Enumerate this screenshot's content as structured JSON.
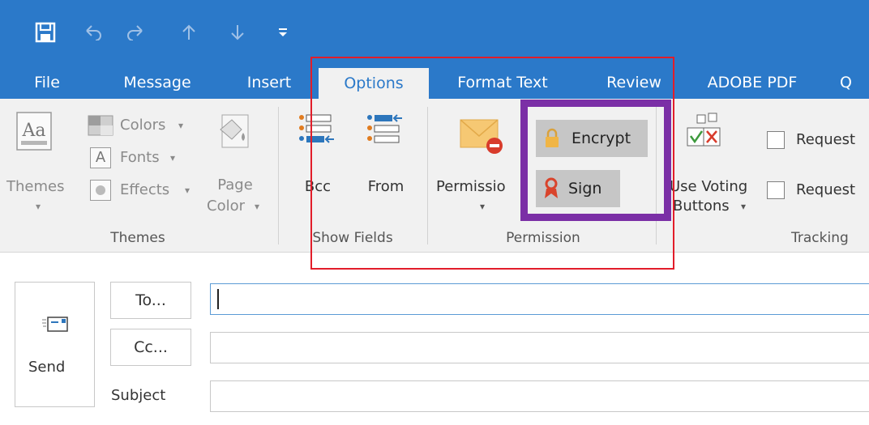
{
  "quick_access": {
    "save_icon": "save-icon",
    "undo_icon": "undo-icon",
    "redo_icon": "redo-icon",
    "up_icon": "up-arrow-icon",
    "down_icon": "down-arrow-icon",
    "customize_icon": "customize-toolbar-icon"
  },
  "tabs": [
    {
      "label": "File"
    },
    {
      "label": "Message"
    },
    {
      "label": "Insert"
    },
    {
      "label": "Options",
      "active": true
    },
    {
      "label": "Format Text"
    },
    {
      "label": "Review"
    },
    {
      "label": "ADOBE PDF"
    },
    {
      "label": "Q"
    }
  ],
  "ribbon": {
    "themes_group": {
      "themes_label": "Themes",
      "colors_label": "Colors",
      "fonts_label": "Fonts",
      "effects_label": "Effects",
      "page_color_label_1": "Page",
      "page_color_label_2": "Color",
      "group_label": "Themes"
    },
    "show_fields_group": {
      "bcc_label": "Bcc",
      "from_label": "From",
      "group_label": "Show Fields"
    },
    "permission_group": {
      "permission_label": "Permissio",
      "encrypt_label": "Encrypt",
      "sign_label": "Sign",
      "group_label": "Permission"
    },
    "voting_group": {
      "voting_label_1": "Use Voting",
      "voting_label_2": "Buttons"
    },
    "tracking_group": {
      "request_1": "Request",
      "request_2": "Request",
      "group_label": "Tracking"
    }
  },
  "compose": {
    "send_label": "Send",
    "to_label": "To...",
    "cc_label": "Cc...",
    "subject_label": "Subject",
    "to_value": "",
    "cc_value": "",
    "subject_value": ""
  },
  "colors": {
    "title_blue": "#2b79c9",
    "highlight_red": "#e21d2a",
    "highlight_purple": "#7b2fa6"
  }
}
